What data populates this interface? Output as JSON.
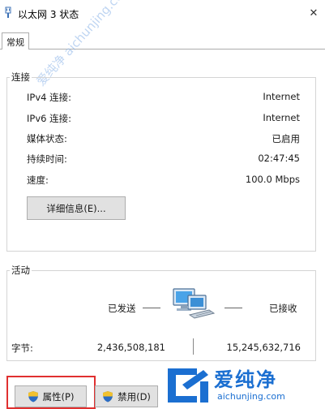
{
  "window": {
    "title": "以太网 3 状态",
    "close_glyph": "✕"
  },
  "tabs": [
    {
      "label": "常规"
    }
  ],
  "connection": {
    "group_label": "连接",
    "rows": [
      {
        "label": "IPv4 连接:",
        "value": "Internet"
      },
      {
        "label": "IPv6 连接:",
        "value": "Internet"
      },
      {
        "label": "媒体状态:",
        "value": "已启用"
      },
      {
        "label": "持续时间:",
        "value": "02:47:45"
      },
      {
        "label": "速度:",
        "value": "100.0 Mbps"
      }
    ],
    "details_button": "详细信息(E)..."
  },
  "activity": {
    "group_label": "活动",
    "sent_label": "已发送",
    "received_label": "已接收",
    "bytes_label": "字节:",
    "bytes_sent": "2,436,508,181",
    "bytes_received": "15,245,632,716"
  },
  "buttons": {
    "properties": "属性(P)",
    "disable": "禁用(D)"
  },
  "watermark": {
    "brand_cn": "爱纯净",
    "brand_url": "aichunjing.com",
    "diagonal_text": "爱纯净 aichunjing.com"
  },
  "colors": {
    "highlight_box": "#e03030",
    "brand_blue": "#1b6fd1",
    "shield_blue": "#2b6cc4",
    "shield_yellow": "#f2c12e"
  }
}
